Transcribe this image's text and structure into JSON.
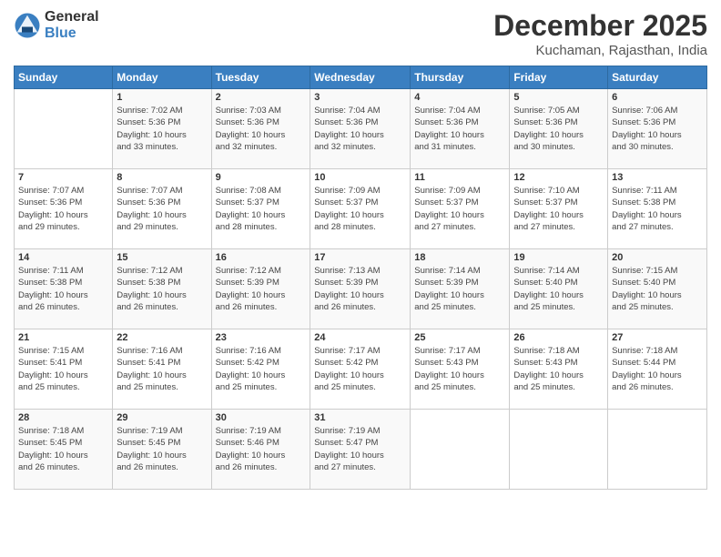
{
  "logo": {
    "general": "General",
    "blue": "Blue"
  },
  "title": "December 2025",
  "location": "Kuchaman, Rajasthan, India",
  "days_of_week": [
    "Sunday",
    "Monday",
    "Tuesday",
    "Wednesday",
    "Thursday",
    "Friday",
    "Saturday"
  ],
  "weeks": [
    [
      {
        "day": "",
        "info": ""
      },
      {
        "day": "1",
        "info": "Sunrise: 7:02 AM\nSunset: 5:36 PM\nDaylight: 10 hours\nand 33 minutes."
      },
      {
        "day": "2",
        "info": "Sunrise: 7:03 AM\nSunset: 5:36 PM\nDaylight: 10 hours\nand 32 minutes."
      },
      {
        "day": "3",
        "info": "Sunrise: 7:04 AM\nSunset: 5:36 PM\nDaylight: 10 hours\nand 32 minutes."
      },
      {
        "day": "4",
        "info": "Sunrise: 7:04 AM\nSunset: 5:36 PM\nDaylight: 10 hours\nand 31 minutes."
      },
      {
        "day": "5",
        "info": "Sunrise: 7:05 AM\nSunset: 5:36 PM\nDaylight: 10 hours\nand 30 minutes."
      },
      {
        "day": "6",
        "info": "Sunrise: 7:06 AM\nSunset: 5:36 PM\nDaylight: 10 hours\nand 30 minutes."
      }
    ],
    [
      {
        "day": "7",
        "info": "Sunrise: 7:07 AM\nSunset: 5:36 PM\nDaylight: 10 hours\nand 29 minutes."
      },
      {
        "day": "8",
        "info": "Sunrise: 7:07 AM\nSunset: 5:36 PM\nDaylight: 10 hours\nand 29 minutes."
      },
      {
        "day": "9",
        "info": "Sunrise: 7:08 AM\nSunset: 5:37 PM\nDaylight: 10 hours\nand 28 minutes."
      },
      {
        "day": "10",
        "info": "Sunrise: 7:09 AM\nSunset: 5:37 PM\nDaylight: 10 hours\nand 28 minutes."
      },
      {
        "day": "11",
        "info": "Sunrise: 7:09 AM\nSunset: 5:37 PM\nDaylight: 10 hours\nand 27 minutes."
      },
      {
        "day": "12",
        "info": "Sunrise: 7:10 AM\nSunset: 5:37 PM\nDaylight: 10 hours\nand 27 minutes."
      },
      {
        "day": "13",
        "info": "Sunrise: 7:11 AM\nSunset: 5:38 PM\nDaylight: 10 hours\nand 27 minutes."
      }
    ],
    [
      {
        "day": "14",
        "info": "Sunrise: 7:11 AM\nSunset: 5:38 PM\nDaylight: 10 hours\nand 26 minutes."
      },
      {
        "day": "15",
        "info": "Sunrise: 7:12 AM\nSunset: 5:38 PM\nDaylight: 10 hours\nand 26 minutes."
      },
      {
        "day": "16",
        "info": "Sunrise: 7:12 AM\nSunset: 5:39 PM\nDaylight: 10 hours\nand 26 minutes."
      },
      {
        "day": "17",
        "info": "Sunrise: 7:13 AM\nSunset: 5:39 PM\nDaylight: 10 hours\nand 26 minutes."
      },
      {
        "day": "18",
        "info": "Sunrise: 7:14 AM\nSunset: 5:39 PM\nDaylight: 10 hours\nand 25 minutes."
      },
      {
        "day": "19",
        "info": "Sunrise: 7:14 AM\nSunset: 5:40 PM\nDaylight: 10 hours\nand 25 minutes."
      },
      {
        "day": "20",
        "info": "Sunrise: 7:15 AM\nSunset: 5:40 PM\nDaylight: 10 hours\nand 25 minutes."
      }
    ],
    [
      {
        "day": "21",
        "info": "Sunrise: 7:15 AM\nSunset: 5:41 PM\nDaylight: 10 hours\nand 25 minutes."
      },
      {
        "day": "22",
        "info": "Sunrise: 7:16 AM\nSunset: 5:41 PM\nDaylight: 10 hours\nand 25 minutes."
      },
      {
        "day": "23",
        "info": "Sunrise: 7:16 AM\nSunset: 5:42 PM\nDaylight: 10 hours\nand 25 minutes."
      },
      {
        "day": "24",
        "info": "Sunrise: 7:17 AM\nSunset: 5:42 PM\nDaylight: 10 hours\nand 25 minutes."
      },
      {
        "day": "25",
        "info": "Sunrise: 7:17 AM\nSunset: 5:43 PM\nDaylight: 10 hours\nand 25 minutes."
      },
      {
        "day": "26",
        "info": "Sunrise: 7:18 AM\nSunset: 5:43 PM\nDaylight: 10 hours\nand 25 minutes."
      },
      {
        "day": "27",
        "info": "Sunrise: 7:18 AM\nSunset: 5:44 PM\nDaylight: 10 hours\nand 26 minutes."
      }
    ],
    [
      {
        "day": "28",
        "info": "Sunrise: 7:18 AM\nSunset: 5:45 PM\nDaylight: 10 hours\nand 26 minutes."
      },
      {
        "day": "29",
        "info": "Sunrise: 7:19 AM\nSunset: 5:45 PM\nDaylight: 10 hours\nand 26 minutes."
      },
      {
        "day": "30",
        "info": "Sunrise: 7:19 AM\nSunset: 5:46 PM\nDaylight: 10 hours\nand 26 minutes."
      },
      {
        "day": "31",
        "info": "Sunrise: 7:19 AM\nSunset: 5:47 PM\nDaylight: 10 hours\nand 27 minutes."
      },
      {
        "day": "",
        "info": ""
      },
      {
        "day": "",
        "info": ""
      },
      {
        "day": "",
        "info": ""
      }
    ]
  ]
}
